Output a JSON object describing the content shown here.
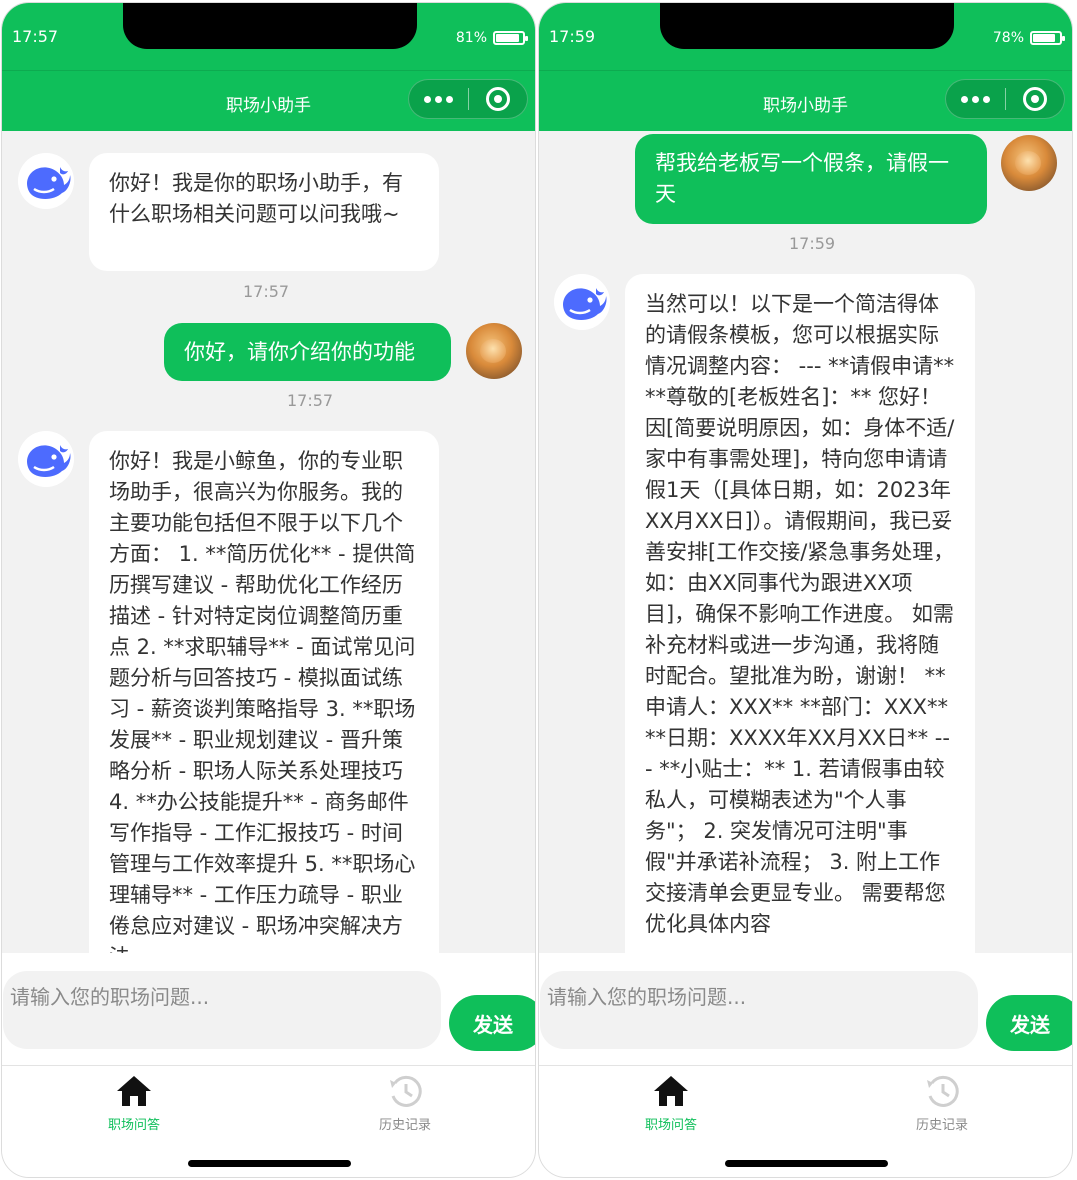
{
  "screens": [
    {
      "status": {
        "time": "17:57",
        "battery": "81%",
        "battery_level": 0.81
      },
      "header": {
        "title": "职场小助手",
        "more_icon": "more-dots-icon",
        "close_icon": "target-circle-icon"
      },
      "messages": [
        {
          "from": "assistant",
          "text": "你好！我是你的职场小助手，有什么职场相关问题可以问我哦~",
          "time": "17:57"
        },
        {
          "from": "user",
          "text": "你好，请你介绍你的功能",
          "time": "17:57"
        },
        {
          "from": "assistant",
          "text": "你好！我是小鲸鱼，你的专业职场助手，很高兴为你服务。我的主要功能包括但不限于以下几个方面： 1. **简历优化** - 提供简历撰写建议 - 帮助优化工作经历描述 - 针对特定岗位调整简历重点 2. **求职辅导** - 面试常见问题分析与回答技巧 - 模拟面试练习 - 薪资谈判策略指导 3. **职场发展** - 职业规划建议 - 晋升策略分析 - 职场人际关系处理技巧 4. **办公技能提升** - 商务邮件写作指导 - 工作汇报技巧 - 时间管理与工作效率提升 5. **职场心理辅导** - 工作压力疏导 - 职业倦怠应对建议 - 职场冲突解决方法"
        }
      ],
      "input": {
        "placeholder": "请输入您的职场问题...",
        "send_label": "发送"
      },
      "tabs": [
        {
          "label": "职场问答",
          "icon": "home-icon",
          "active": true
        },
        {
          "label": "历史记录",
          "icon": "history-icon",
          "active": false
        }
      ]
    },
    {
      "status": {
        "time": "17:59",
        "battery": "78%",
        "battery_level": 0.78
      },
      "header": {
        "title": "职场小助手",
        "more_icon": "more-dots-icon",
        "close_icon": "target-circle-icon"
      },
      "messages": [
        {
          "from": "user",
          "text": "帮我给老板写一个假条，请假一天",
          "time": "17:59"
        },
        {
          "from": "assistant",
          "text": "当然可以！以下是一个简洁得体的请假条模板，您可以根据实际情况调整内容： --- **请假申请** **尊敬的[老板姓名]：** 您好！因[简要说明原因，如：身体不适/家中有事需处理]，特向您申请请假1天（[具体日期，如：2023年XX月XX日]）。请假期间，我已妥善安排[工作交接/紧急事务处理，如：由XX同事代为跟进XX项目]，确保不影响工作进度。 如需补充材料或进一步沟通，我将随时配合。望批准为盼，谢谢！ **申请人：XXX** **部门：XXX** **日期：XXXX年XX月XX日** --- **小贴士：** 1. 若请假事由较私人，可模糊表述为\"个人事务\"； 2. 突发情况可注明\"事假\"并承诺补流程； 3. 附上工作交接清单会更显专业。 需要帮您优化具体内容"
        }
      ],
      "input": {
        "placeholder": "请输入您的职场问题...",
        "send_label": "发送"
      },
      "tabs": [
        {
          "label": "职场问答",
          "icon": "home-icon",
          "active": true
        },
        {
          "label": "历史记录",
          "icon": "history-icon",
          "active": false
        }
      ]
    }
  ]
}
